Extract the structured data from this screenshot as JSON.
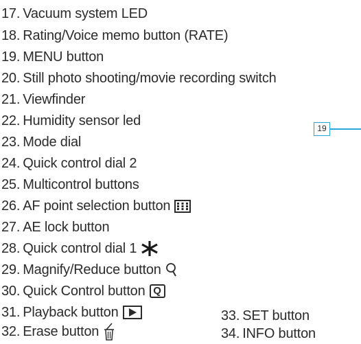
{
  "items": [
    {
      "num": "17.",
      "label": "Vacuum system LED",
      "icon": null
    },
    {
      "num": "18.",
      "label": "Rating/Voice memo button (RATE)",
      "icon": null
    },
    {
      "num": "19.",
      "label": "MENU button",
      "icon": null
    },
    {
      "num": "20.",
      "label": "Still photo shooting/movie recording switch",
      "icon": null
    },
    {
      "num": "21.",
      "label": "Viewfinder",
      "icon": null
    },
    {
      "num": "22.",
      "label": "Humidity sensor led",
      "icon": null
    },
    {
      "num": "23.",
      "label": "Mode dial",
      "icon": null
    },
    {
      "num": "24.",
      "label": "Quick control dial 2",
      "icon": null
    },
    {
      "num": "25.",
      "label": "Multicontrol buttons",
      "icon": null
    },
    {
      "num": "26.",
      "label": "AF point selection button",
      "icon": "af-point-icon"
    },
    {
      "num": "27.",
      "label": "AE lock button",
      "icon": null
    },
    {
      "num": "28.",
      "label": "Quick control dial 1",
      "icon": "asterisk-icon"
    },
    {
      "num": "29.",
      "label": "Magnify/Reduce button",
      "icon": "magnify-icon"
    },
    {
      "num": "30.",
      "label": "Quick Control button",
      "icon": "q-button-icon"
    },
    {
      "num": "31.",
      "label": "Playback button",
      "icon": "playback-icon"
    },
    {
      "num": "32.",
      "label": "Erase button",
      "icon": "trash-icon"
    },
    {
      "num": "33.",
      "label": "SET button",
      "icon": null
    },
    {
      "num": "34.",
      "label": "INFO button",
      "icon": null
    }
  ],
  "q_icon_text": "Q",
  "callout": {
    "label": "19",
    "color": "#29a6df"
  }
}
